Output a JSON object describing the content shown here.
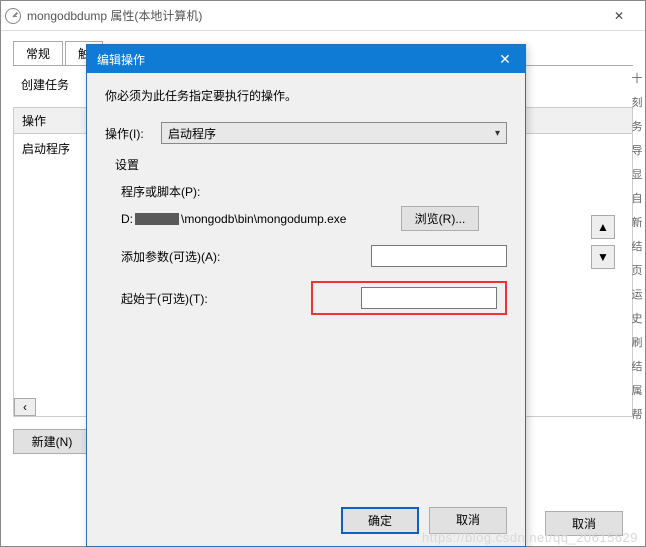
{
  "props": {
    "title": "mongodbdump 属性(本地计算机)",
    "tab_general": "常规",
    "tab_trigger_prefix": "触",
    "create_label": "创建任务",
    "col_action": "操作",
    "row_start": "启动程序",
    "new_btn": "新建(N)",
    "cancel_btn": "取消"
  },
  "dialog": {
    "title": "编辑操作",
    "instruction": "你必须为此任务指定要执行的操作。",
    "action_label": "操作(I):",
    "action_value": "启动程序",
    "settings_label": "设置",
    "script_label": "程序或脚本(P):",
    "script_prefix": "D:",
    "script_suffix": "\\mongodb\\bin\\mongodump.exe",
    "browse_btn": "浏览(R)...",
    "args_label": "添加参数(可选)(A):",
    "args_value": "",
    "startin_label": "起始于(可选)(T):",
    "startin_value": "",
    "ok_btn": "确定",
    "cancel_btn": "取消"
  },
  "right_glyphs": [
    "十",
    "刻",
    "务",
    "导",
    "显",
    "自",
    "新",
    "结",
    "页",
    "运",
    "史",
    "刷",
    "结",
    "属",
    "帮"
  ],
  "nav": {
    "up": "▲",
    "down": "▼"
  },
  "watermark": "https://blog.csdn.net/qq_20615629"
}
